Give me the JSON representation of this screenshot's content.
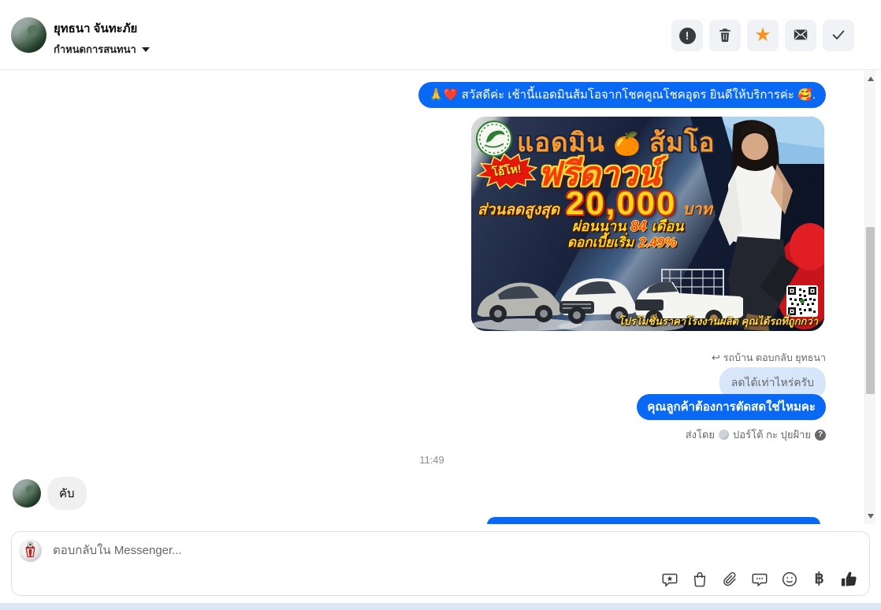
{
  "header": {
    "name": "ยุทธนา จันทะภัย",
    "subtitle": "กำหนดการสนทนา",
    "action_icons": [
      "report-icon",
      "trash-icon",
      "star-icon",
      "mark-unread-icon",
      "done-check-icon"
    ]
  },
  "chat": {
    "greeting_message": "🙏❤️ สวัสดีค่ะ เช้านี้แอดมินส้มโอจากโชคคูณโชคอุดร ยินดีให้บริการค่ะ 🥰.",
    "ad": {
      "title_left": "แอดมิน",
      "title_emoji": "🍊",
      "title_right": "ส้มโอ",
      "burst_text": "โอ้โห!",
      "headline": "ฟรีดาวน์",
      "discount_label": "ส่วนลดสูงสุด",
      "discount_value": "20,000",
      "discount_unit": "บาท",
      "installment_label": "ผ่อนนาน",
      "installment_value": "84",
      "installment_unit": "เดือน",
      "interest_label": "ดอกเบี้ยเริ่ม",
      "interest_value": "2.49%",
      "caption": "โปรโมชั่นราคาโรงงานผลิต คุณได้รถที่ถูกกว่า"
    },
    "reply_context": "รถบ้าน ตอบกลับ ยุทธนา",
    "quoted_message": "ลดได้เท่าไหร่ครับ",
    "question_message": "คุณลูกค้าต้องการตัดสดใช่ไหมคะ",
    "sent_by_label": "ส่งโดย",
    "sent_by_name": "ปอร์โต้ กะ ปุยฝ้าย",
    "timestamp": "11:49",
    "received_message": "คับ"
  },
  "composer": {
    "placeholder": "ตอบกลับใน Messenger...",
    "icons": [
      "saved-replies-icon",
      "bag-icon",
      "paperclip-icon",
      "comment-icon",
      "emoji-icon",
      "baht-icon",
      "like-icon"
    ],
    "baht_symbol": "฿"
  },
  "colors": {
    "sent_bubble": "#0a69f4",
    "quoted_bubble": "#d8e6fb",
    "received_bubble": "#f0f0f0",
    "star_accent": "#f6921e",
    "bottom_strip": "#dde6f5"
  }
}
